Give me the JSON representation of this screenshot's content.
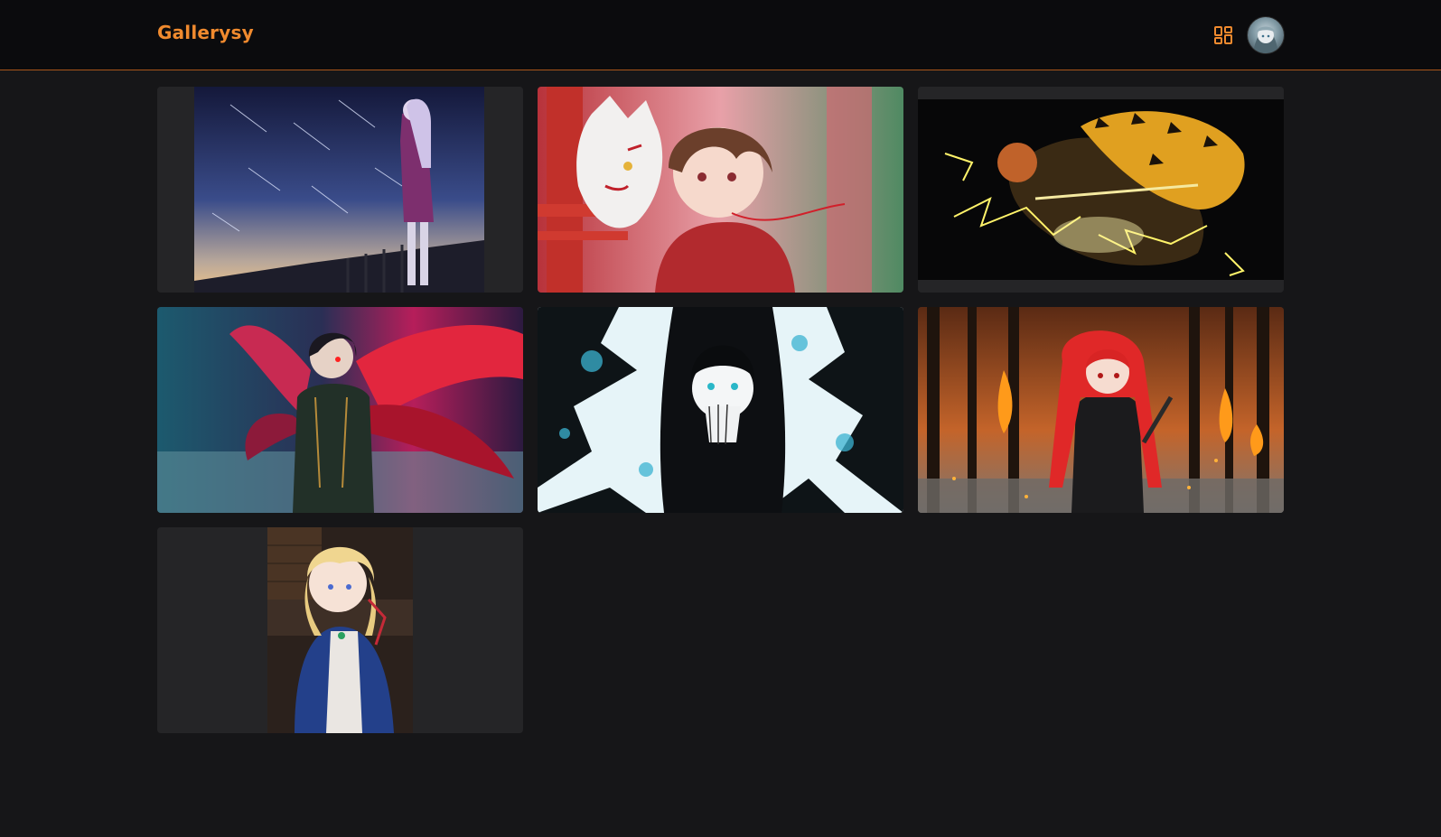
{
  "app": {
    "brand": "Gallerysy"
  },
  "header": {
    "grid_icon": "grid-view-icon",
    "avatar_icon": "user-avatar"
  },
  "colors": {
    "accent": "#f08a2e",
    "header_bg": "#0b0b0d",
    "page_bg": "#161618",
    "card_bg": "#252527"
  },
  "gallery": {
    "images": [
      {
        "subject": "girl-meteor-shower-night-sky"
      },
      {
        "subject": "girl-kitsune-mask-torii"
      },
      {
        "subject": "lightning-swordsman-dark"
      },
      {
        "subject": "crimson-winged-boy-nebula"
      },
      {
        "subject": "dark-haired-girl-ink-splash"
      },
      {
        "subject": "red-haired-girl-burning-forest"
      },
      {
        "subject": "blonde-girl-blue-dress-night"
      }
    ]
  }
}
